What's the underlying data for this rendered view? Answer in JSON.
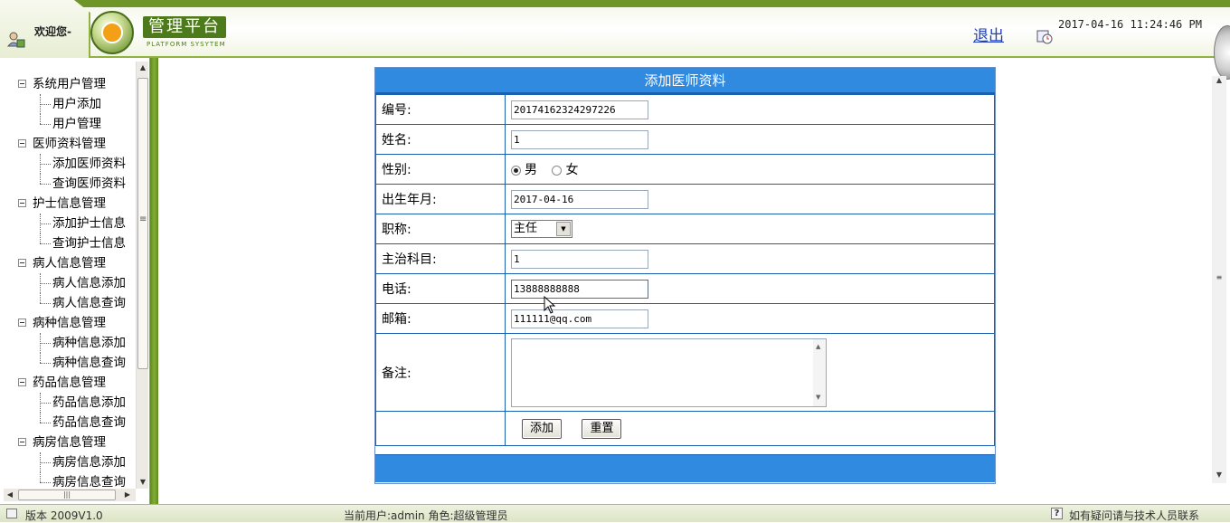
{
  "header": {
    "welcome": "欢迎您-",
    "logo_title": "管理平台",
    "logo_subtitle": "PLATFORM SYSYTEM",
    "logout": "退出",
    "datetime": "2017-04-16 11:24:46 PM"
  },
  "sidebar": {
    "groups": [
      {
        "label": "系统用户管理",
        "children": [
          "用户添加",
          "用户管理"
        ]
      },
      {
        "label": "医师资料管理",
        "children": [
          "添加医师资料",
          "查询医师资料"
        ]
      },
      {
        "label": "护士信息管理",
        "children": [
          "添加护士信息",
          "查询护士信息"
        ]
      },
      {
        "label": "病人信息管理",
        "children": [
          "病人信息添加",
          "病人信息查询"
        ]
      },
      {
        "label": "病种信息管理",
        "children": [
          "病种信息添加",
          "病种信息查询"
        ]
      },
      {
        "label": "药品信息管理",
        "children": [
          "药品信息添加",
          "药品信息查询"
        ]
      },
      {
        "label": "病房信息管理",
        "children": [
          "病房信息添加",
          "病房信息查询"
        ]
      }
    ]
  },
  "form": {
    "title": "添加医师资料",
    "fields": {
      "id": {
        "label": "编号:",
        "value": "20174162324297226"
      },
      "name": {
        "label": "姓名:",
        "value": "1"
      },
      "gender": {
        "label": "性别:",
        "option_male": "男",
        "option_female": "女",
        "selected": "男"
      },
      "birth": {
        "label": "出生年月:",
        "value": "2017-04-16"
      },
      "title": {
        "label": "职称:",
        "value": "主任"
      },
      "subject": {
        "label": "主治科目:",
        "value": "1"
      },
      "phone": {
        "label": "电话:",
        "value": "13888888888"
      },
      "email": {
        "label": "邮箱:",
        "value": "111111@qq.com"
      },
      "remark": {
        "label": "备注:",
        "value": ""
      }
    },
    "buttons": {
      "add": "添加",
      "reset": "重置"
    }
  },
  "statusbar": {
    "version": "版本 2009V1.0",
    "current_user": "当前用户:admin 角色:超级管理员",
    "contact": "如有疑问请与技术人员联系"
  },
  "colors": {
    "header_green": "#6e9528",
    "form_blue": "#2f8ae0",
    "link_blue": "#1f3fbf"
  }
}
